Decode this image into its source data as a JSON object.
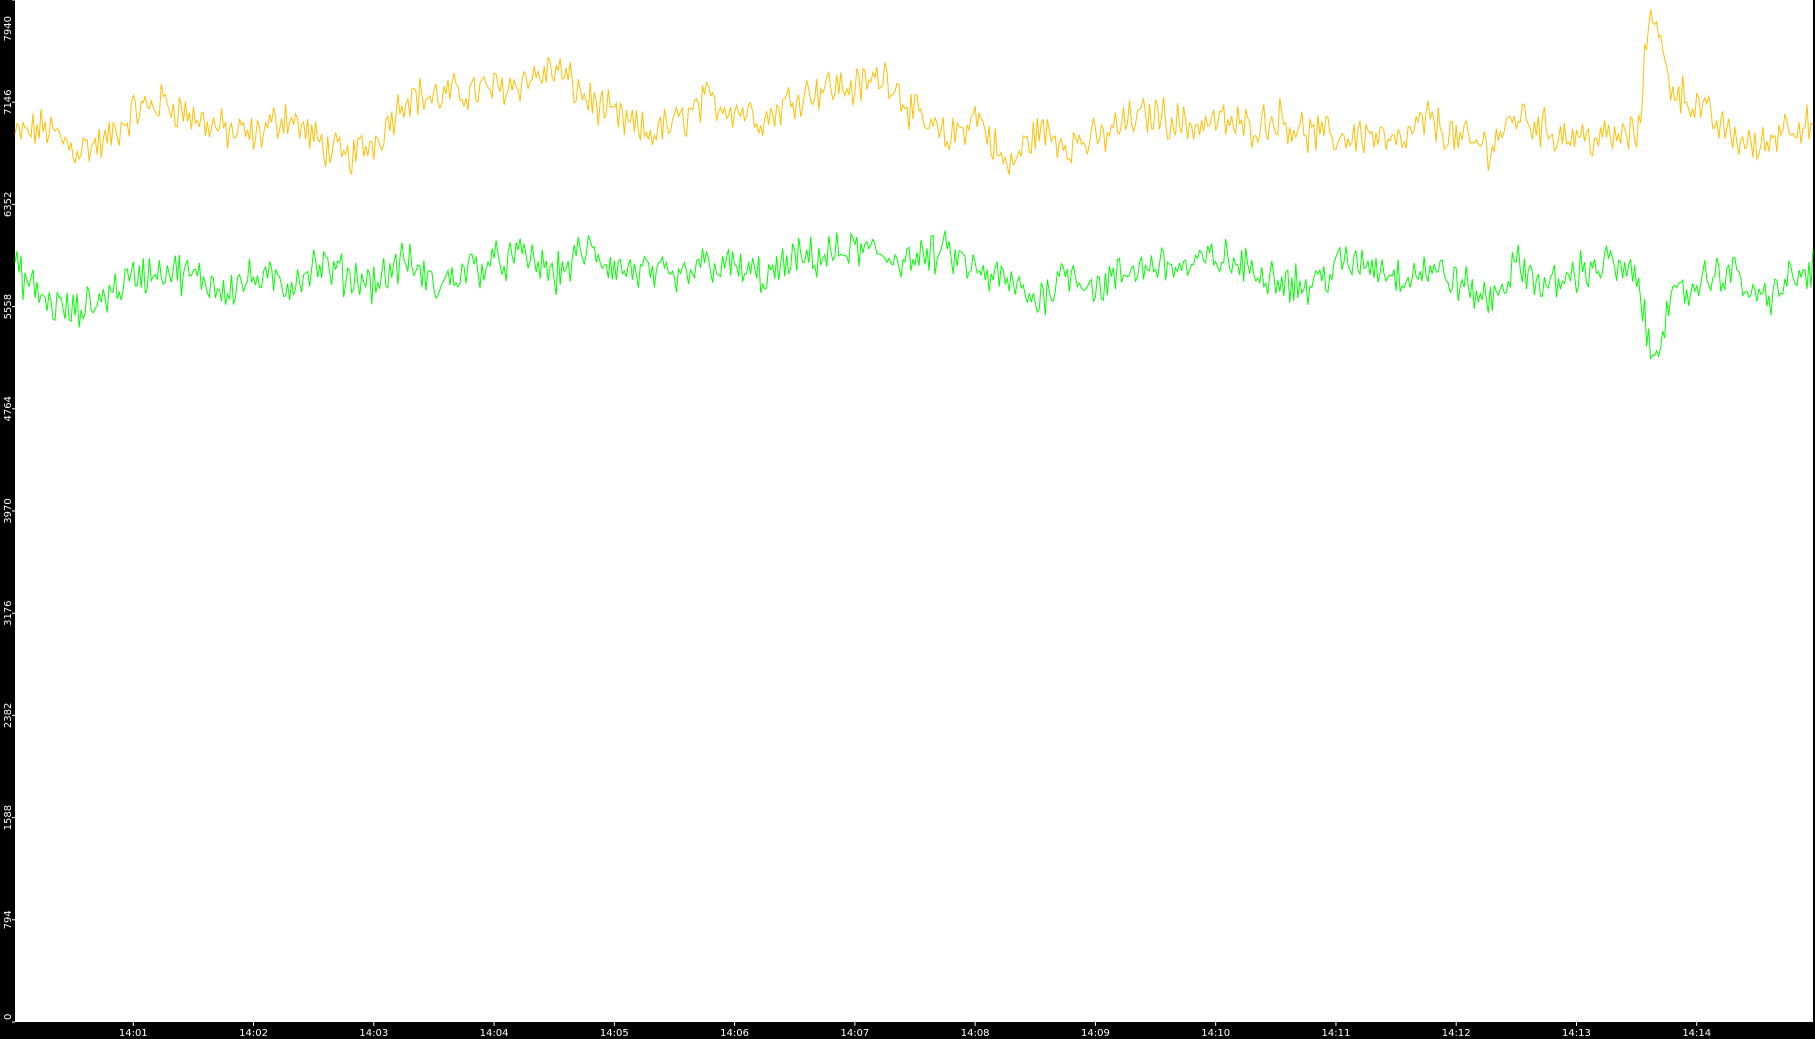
{
  "chart_data": {
    "type": "line",
    "title": "",
    "xlabel": "",
    "ylabel": "",
    "ylim": [
      0,
      7940
    ],
    "y_ticks": [
      0,
      794,
      1588,
      2382,
      3176,
      3970,
      4764,
      5558,
      6352,
      7146,
      7940
    ],
    "y_tick_labels": [
      "0",
      "794",
      "1588",
      "2382",
      "3176",
      "3970",
      "4764",
      "5558",
      "6352",
      "7146",
      "7940"
    ],
    "x_tick_labels": [
      "14:01",
      "14:02",
      "14:03",
      "14:04",
      "14:05",
      "14:06",
      "14:07",
      "14:08",
      "14:09",
      "14:10",
      "14:11",
      "14:12",
      "14:13",
      "14:14"
    ],
    "xlim": [
      "14:00:01",
      "14:14:58"
    ],
    "background_color": "#ffffff",
    "axis_color": "#000000",
    "tick_label_color": "#ffffff",
    "grid": false,
    "legend": "none",
    "series": [
      {
        "color": "#ffbf00",
        "x": [
          "14:00:01",
          "14:00:16",
          "14:00:31",
          "14:00:46",
          "14:01:01",
          "14:01:16",
          "14:01:31",
          "14:01:46",
          "14:02:01",
          "14:02:16",
          "14:02:31",
          "14:02:46",
          "14:03:01",
          "14:03:16",
          "14:03:31",
          "14:03:46",
          "14:04:01",
          "14:04:16",
          "14:04:31",
          "14:04:46",
          "14:05:01",
          "14:05:16",
          "14:05:31",
          "14:05:46",
          "14:06:01",
          "14:06:16",
          "14:06:31",
          "14:06:46",
          "14:07:01",
          "14:07:16",
          "14:07:31",
          "14:07:46",
          "14:08:01",
          "14:08:16",
          "14:08:31",
          "14:08:46",
          "14:09:01",
          "14:09:16",
          "14:09:31",
          "14:09:46",
          "14:10:01",
          "14:10:16",
          "14:10:31",
          "14:10:46",
          "14:11:01",
          "14:11:16",
          "14:11:31",
          "14:11:46",
          "14:12:01",
          "14:12:16",
          "14:12:31",
          "14:12:46",
          "14:13:01",
          "14:13:16",
          "14:13:31",
          "14:13:37",
          "14:13:46",
          "14:14:01",
          "14:14:16",
          "14:14:31",
          "14:14:46",
          "14:14:58"
        ],
        "values": [
          6880,
          6950,
          6780,
          6830,
          7080,
          7150,
          7020,
          6920,
          6880,
          7050,
          6850,
          6700,
          6850,
          7200,
          7180,
          7230,
          7250,
          7320,
          7400,
          7180,
          7020,
          6900,
          6980,
          7150,
          7100,
          7020,
          7200,
          7270,
          7260,
          7370,
          7020,
          6850,
          7050,
          6620,
          6930,
          6830,
          6850,
          7000,
          7060,
          6960,
          7000,
          6950,
          7030,
          6900,
          6870,
          6900,
          6800,
          7020,
          6850,
          6800,
          7050,
          6920,
          6880,
          6860,
          6900,
          7950,
          7300,
          7100,
          6900,
          6780,
          7000,
          6950
        ]
      },
      {
        "color": "#00ff00",
        "x": [
          "14:00:01",
          "14:00:16",
          "14:00:31",
          "14:00:46",
          "14:01:01",
          "14:01:16",
          "14:01:31",
          "14:01:46",
          "14:02:01",
          "14:02:16",
          "14:02:31",
          "14:02:46",
          "14:03:01",
          "14:03:16",
          "14:03:31",
          "14:03:46",
          "14:04:01",
          "14:04:16",
          "14:04:31",
          "14:04:46",
          "14:05:01",
          "14:05:16",
          "14:05:31",
          "14:05:46",
          "14:06:01",
          "14:06:16",
          "14:06:31",
          "14:06:46",
          "14:07:01",
          "14:07:16",
          "14:07:31",
          "14:07:46",
          "14:08:01",
          "14:08:16",
          "14:08:31",
          "14:08:46",
          "14:09:01",
          "14:09:16",
          "14:09:31",
          "14:09:46",
          "14:10:01",
          "14:10:16",
          "14:10:31",
          "14:10:46",
          "14:11:01",
          "14:11:16",
          "14:11:31",
          "14:11:46",
          "14:12:01",
          "14:12:16",
          "14:12:31",
          "14:12:46",
          "14:13:01",
          "14:13:16",
          "14:13:31",
          "14:13:37",
          "14:13:46",
          "14:14:01",
          "14:14:16",
          "14:14:31",
          "14:14:46",
          "14:14:58"
        ],
        "values": [
          5850,
          5600,
          5500,
          5650,
          5800,
          5850,
          5780,
          5700,
          5780,
          5720,
          5880,
          5800,
          5750,
          5920,
          5700,
          5850,
          5900,
          5950,
          5800,
          6000,
          5850,
          5820,
          5750,
          5900,
          5850,
          5780,
          5920,
          5950,
          6000,
          5950,
          5920,
          5980,
          5820,
          5750,
          5600,
          5850,
          5700,
          5820,
          5900,
          5850,
          5950,
          5850,
          5800,
          5700,
          5880,
          5900,
          5800,
          5850,
          5750,
          5600,
          5880,
          5700,
          5830,
          5900,
          5750,
          5150,
          5550,
          5750,
          5850,
          5600,
          5750,
          5850
        ]
      }
    ]
  }
}
